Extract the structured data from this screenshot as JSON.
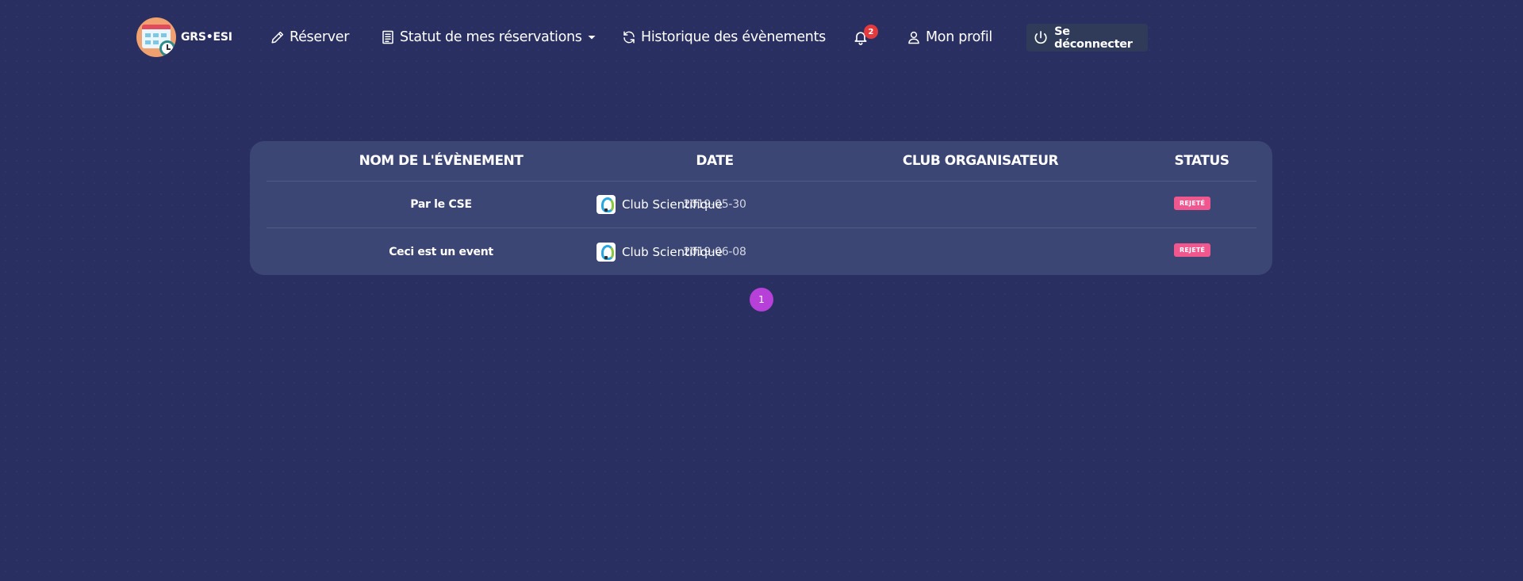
{
  "brand": {
    "name": "GRS•ESI"
  },
  "nav": {
    "reserve": "Réserver",
    "status": "Statut de mes réservations",
    "history": "Historique des évènements",
    "notifications_count": "2",
    "profile": "Mon profil",
    "logout": "Se déconnecter"
  },
  "table": {
    "headers": [
      "NOM DE L'ÉVÈNEMENT",
      "DATE",
      "CLUB ORGANISATEUR",
      "STATUS"
    ],
    "rows": [
      {
        "name": "Par le CSE",
        "date": "2019-05-30",
        "club": "Club Scientifique",
        "status": "REJETÉ"
      },
      {
        "name": "Ceci est un event",
        "date": "2019-06-08",
        "club": "Club Scientifique",
        "status": "REJETÉ"
      }
    ]
  },
  "pagination": {
    "current": "1"
  },
  "colors": {
    "background": "#2a2f62",
    "card": "#3c4674",
    "badge_rejected": "#f0578e",
    "notification_badge": "#e4393d",
    "page_active": "#b640d8",
    "logout_button": "#2f3b58"
  }
}
